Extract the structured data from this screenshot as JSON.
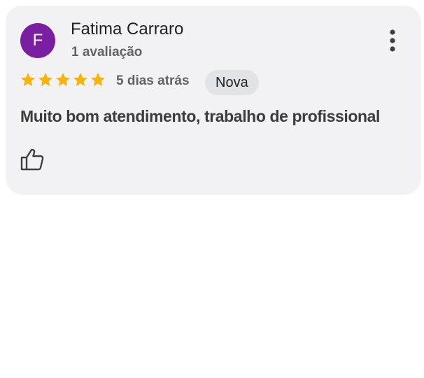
{
  "review": {
    "avatar_letter": "F",
    "avatar_color": "#7b1fa2",
    "author_name": "Fatima Carraro",
    "author_reviews": "1 avaliação",
    "rating": 5,
    "rating_max": 5,
    "star_color": "#f9b300",
    "date": "5 dias atrás",
    "badge": "Nova",
    "text": "Muito bom atendimento, trabalho de profissional"
  },
  "icons": {
    "more": "more-vert-icon",
    "like": "thumb-up-outline-icon",
    "star": "star-icon"
  }
}
